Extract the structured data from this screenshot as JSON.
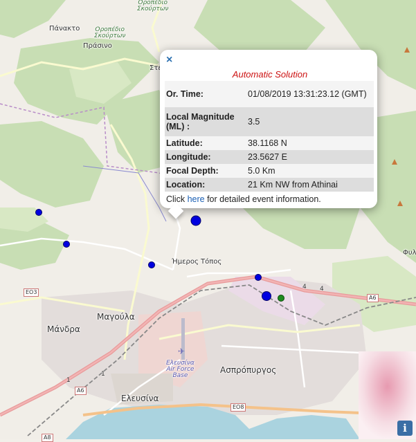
{
  "places": {
    "oropedio_skourton_top": "Οροπέδιο\nΣκούρτων",
    "panakto": "Πάνακτο",
    "oropedio_skourton": "Οροπέδιο\nΣκούρτων",
    "prasino": "Πράσινο",
    "ste": "Στεφ",
    "imeros_topos": "Ήμερος Τόπος",
    "magoula": "Μαγούλα",
    "mandra": "Μάνδρα",
    "elefsina": "Ελευσίνα",
    "aspropyrgos": "Ασπρόπυργος",
    "fyli": "Φυλ",
    "air_base": "Ελευσίνα\nAir Force\nBase"
  },
  "roads": {
    "eo3": "ΕΟ3",
    "a6_left": "Α6",
    "a6_right": "Α6",
    "eo8": "ΕΟ8",
    "a8": "Α8",
    "num_4a": "4",
    "num_4b": "4",
    "num_1a": "1",
    "num_1b": "1"
  },
  "popup": {
    "close_icon": "×",
    "header": "Automatic Solution",
    "rows": [
      {
        "label": "Or. Time:",
        "value": "01/08/2019 13:31:23.12 (GMT)"
      },
      {
        "label": "Local Magnitude (ML) :",
        "value": "3.5"
      },
      {
        "label": "Latitude:",
        "value": "38.1168 N"
      },
      {
        "label": "Longitude:",
        "value": "23.5627 E"
      },
      {
        "label": "Focal Depth:",
        "value": "5.0 Km"
      },
      {
        "label": "Location:",
        "value": "21 Km NW from Athinai"
      }
    ],
    "footer_before": "Click ",
    "footer_link": "here",
    "footer_after": " for detailed event information."
  },
  "info_button": "i",
  "colors": {
    "event_marker": "#0000e0",
    "station_marker": "#1f8a1f",
    "popup_header": "#cc1111",
    "link": "#1a5fb4"
  }
}
